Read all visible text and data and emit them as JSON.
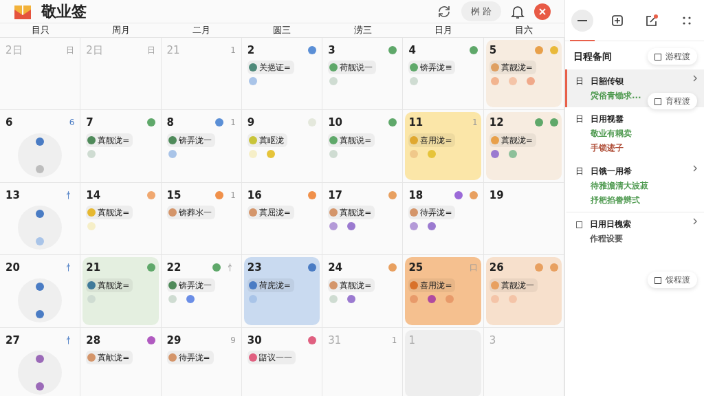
{
  "app": {
    "title": "敬业签",
    "toolbar_pill": "桝 跲"
  },
  "weekdays": [
    "目只",
    "周月",
    "二月",
    "圆三",
    "涝三",
    "日月",
    "目六"
  ],
  "weeks": [
    [
      {
        "day": "2日",
        "kind": "day",
        "muted": true,
        "corner": "日"
      },
      {
        "day": "2日",
        "kind": "day",
        "muted": true,
        "corner": "日"
      },
      {
        "day": "21",
        "kind": "day",
        "muted": true,
        "corner": "1"
      },
      {
        "day": "2",
        "kind": "day",
        "muted": false,
        "badges": [
          {
            "color": "#5b8fd6"
          }
        ],
        "event": {
          "label": "关挹证=",
          "color": "#4f8a7a"
        },
        "dots": [
          {
            "color": "#a9c4e8"
          }
        ]
      },
      {
        "day": "3",
        "kind": "day",
        "muted": false,
        "badges": [
          {
            "color": "#5fa86a"
          }
        ],
        "event": {
          "label": "荷靓说一",
          "color": "#5fa86a"
        },
        "dots": [
          {
            "color": "#cfdcd2"
          }
        ]
      },
      {
        "day": "4",
        "kind": "day",
        "muted": false,
        "badges": [
          {
            "color": "#5fa86a"
          }
        ],
        "event": {
          "label": "锛弄泷≡",
          "color": "#5fa86a"
        },
        "dots": [
          {
            "color": "#cfdcd2"
          }
        ]
      },
      {
        "day": "5",
        "kind": "day",
        "muted": false,
        "highlight": {
          "color": "#f7ece0"
        },
        "badges": [
          {
            "color": "#e8a04a"
          },
          {
            "color": "#e9b93a"
          }
        ],
        "event": {
          "label": "蒖靓泷=",
          "color": "#dfa062"
        },
        "dots": [
          {
            "color": "#f2b48f"
          },
          {
            "color": "#f4c4a8"
          },
          {
            "color": "#f0a98a"
          }
        ]
      }
    ],
    [
      {
        "day": "6",
        "kind": "bubble",
        "muted": false,
        "corner": "6",
        "dots": [
          {
            "color": "#4a7cc4"
          },
          {
            "color": "#bdbdbd"
          }
        ]
      },
      {
        "day": "7",
        "kind": "day",
        "muted": false,
        "badges": [
          {
            "color": "#5fa86a"
          }
        ],
        "event": {
          "label": "蒖靓泷=",
          "color": "#4f8a5a"
        },
        "dots": [
          {
            "color": "#cfdcd2"
          }
        ]
      },
      {
        "day": "8",
        "kind": "day",
        "muted": false,
        "badges": [
          {
            "color": "#5b8fd6"
          }
        ],
        "corner": "1",
        "event": {
          "label": "锛弄泷一",
          "color": "#4f8a5a"
        },
        "dots": [
          {
            "color": "#a9c4e8"
          }
        ]
      },
      {
        "day": "9",
        "kind": "day",
        "muted": false,
        "badges": [
          {
            "color": "#e4e8dc"
          }
        ],
        "event": {
          "label": "蒖眍泷",
          "color": "#c8c43a"
        },
        "dots": [
          {
            "color": "#f6efc8"
          },
          {
            "color": "#e6c43a"
          }
        ]
      },
      {
        "day": "10",
        "kind": "day",
        "muted": false,
        "badges": [
          {
            "color": "#5fa86a"
          }
        ],
        "event": {
          "label": "蒖靓说=",
          "color": "#5fa86a"
        },
        "dots": [
          {
            "color": "#cfdcd2"
          }
        ]
      },
      {
        "day": "11",
        "kind": "day",
        "muted": false,
        "highlight": {
          "color": "#fbe6a8"
        },
        "corner": "1",
        "event": {
          "label": "喜用泷=",
          "color": "#e0a830"
        },
        "dots": [
          {
            "color": "#f0c88a"
          },
          {
            "color": "#e6c43a"
          }
        ]
      },
      {
        "day": "12",
        "kind": "day",
        "muted": false,
        "highlight": {
          "color": "#f7ece0"
        },
        "badges": [
          {
            "color": "#5fa86a"
          },
          {
            "color": "#5fa86a"
          }
        ],
        "event": {
          "label": "蒖靓泷=",
          "color": "#e8a04a"
        },
        "dots": [
          {
            "color": "#9b7ad0"
          },
          {
            "color": "#8dc09a"
          }
        ]
      }
    ],
    [
      {
        "day": "13",
        "kind": "bubble",
        "muted": false,
        "corner": "忄",
        "dots": [
          {
            "color": "#4a7cc4"
          },
          {
            "color": "#a9c4e8"
          }
        ]
      },
      {
        "day": "14",
        "kind": "day",
        "muted": false,
        "badges": [
          {
            "color": "#f0a870"
          }
        ],
        "event": {
          "label": "蒖靓泷=",
          "color": "#e6b830"
        },
        "dots": [
          {
            "color": "#f6efc8"
          }
        ]
      },
      {
        "day": "15",
        "kind": "day",
        "muted": false,
        "badges": [
          {
            "color": "#f0904a"
          }
        ],
        "corner": "1",
        "event": {
          "label": "锛葬氺一",
          "color": "#d4956a"
        }
      },
      {
        "day": "16",
        "kind": "day",
        "muted": false,
        "badges": [
          {
            "color": "#f0904a"
          }
        ],
        "event": {
          "label": "蒖屈泷=",
          "color": "#d4956a"
        }
      },
      {
        "day": "17",
        "kind": "day",
        "muted": false,
        "badges": [
          {
            "color": "#e8a060"
          }
        ],
        "event": {
          "label": "蒖靓泷=",
          "color": "#d4956a"
        },
        "dots": [
          {
            "color": "#b49ad8"
          },
          {
            "color": "#9b7ad0"
          }
        ]
      },
      {
        "day": "18",
        "kind": "day",
        "muted": false,
        "badges": [
          {
            "color": "#9b6ad8"
          },
          {
            "color": "#e8a060"
          }
        ],
        "event": {
          "label": "待弄泷=",
          "color": "#d4956a"
        },
        "dots": [
          {
            "color": "#b49ad8"
          },
          {
            "color": "#9b7ad0"
          }
        ]
      },
      {
        "day": "19",
        "kind": "day",
        "muted": false
      }
    ],
    [
      {
        "day": "20",
        "kind": "bubble",
        "muted": false,
        "corner": "忄",
        "dots": [
          {
            "color": "#4a7cc4"
          },
          {
            "color": "#4a7cc4"
          }
        ]
      },
      {
        "day": "21",
        "kind": "day",
        "muted": false,
        "highlight": {
          "color": "#e4efe0"
        },
        "badges": [
          {
            "color": "#5fa86a"
          }
        ],
        "event": {
          "label": "蒖靓泷=",
          "color": "#3f7a9a"
        },
        "dots": [
          {
            "color": "#cfdcd2"
          }
        ]
      },
      {
        "day": "22",
        "kind": "day",
        "muted": false,
        "badges": [
          {
            "color": "#5fa86a"
          }
        ],
        "corner": "忄",
        "event": {
          "label": "锛弄泷一",
          "color": "#4f8a5a"
        },
        "dots": [
          {
            "color": "#cfdcd2"
          },
          {
            "color": "#6b8ee6"
          }
        ]
      },
      {
        "day": "23",
        "kind": "day",
        "muted": false,
        "highlight": {
          "color": "#c9daf0"
        },
        "badges": [
          {
            "color": "#4a7cc4"
          }
        ],
        "event": {
          "label": "荷庑泷=",
          "color": "#4a7cc4"
        },
        "dots": [
          {
            "color": "#a9c4e8"
          }
        ]
      },
      {
        "day": "24",
        "kind": "day",
        "muted": false,
        "badges": [
          {
            "color": "#e8a060"
          }
        ],
        "event": {
          "label": "蒖靓泷=",
          "color": "#d4956a"
        },
        "dots": [
          {
            "color": "#cfdcd2"
          },
          {
            "color": "#9b7ad0"
          }
        ]
      },
      {
        "day": "25",
        "kind": "day",
        "muted": false,
        "highlight": {
          "color": "#f5c08f"
        },
        "corner": "口",
        "event": {
          "label": "喜用泷=",
          "color": "#d9722a"
        },
        "dots": [
          {
            "color": "#e89a6a"
          },
          {
            "color": "#b04aa0"
          },
          {
            "color": "#e89a6a"
          }
        ]
      },
      {
        "day": "26",
        "kind": "day",
        "muted": false,
        "highlight": {
          "color": "#f7e0cc"
        },
        "badges": [
          {
            "color": "#e8a060"
          },
          {
            "color": "#e8a060"
          }
        ],
        "event": {
          "label": "蒖靓泷一",
          "color": "#e8a060"
        },
        "dots": [
          {
            "color": "#f4c4a8"
          },
          {
            "color": "#f4c4a8"
          }
        ]
      }
    ],
    [
      {
        "day": "27",
        "kind": "bubble",
        "muted": false,
        "corner": "忄",
        "dots": [
          {
            "color": "#9b6ab8"
          },
          {
            "color": "#9b6ab8"
          }
        ]
      },
      {
        "day": "28",
        "kind": "day",
        "muted": false,
        "badges": [
          {
            "color": "#b05ac0"
          }
        ],
        "event": {
          "label": "蒖歒泷=",
          "color": "#d4956a"
        }
      },
      {
        "day": "29",
        "kind": "day",
        "muted": false,
        "corner": "9",
        "event": {
          "label": "待弄泷=",
          "color": "#d4956a"
        }
      },
      {
        "day": "30",
        "kind": "day",
        "muted": false,
        "badges": [
          {
            "color": "#e06080"
          }
        ],
        "event": {
          "label": "鼯议一一",
          "color": "#e06080"
        }
      },
      {
        "day": "31",
        "kind": "day",
        "muted": true,
        "corner": "1"
      },
      {
        "day": "1",
        "kind": "day",
        "muted": true,
        "highlight": {
          "color": "#eeeeee"
        }
      },
      {
        "day": "3",
        "kind": "day",
        "muted": true
      }
    ]
  ],
  "sidebar": {
    "tabs": [
      {
        "kind": "minus",
        "selected": true
      },
      {
        "kind": "board",
        "selected": false
      },
      {
        "kind": "edit",
        "selected": false
      },
      {
        "kind": "dots",
        "selected": false
      }
    ],
    "title": "日程备间",
    "items": [
      {
        "icon": "日",
        "title": "日韶传钡",
        "selected": true,
        "chevron": true,
        "lines": [
          {
            "text": "焈俗青锄求...",
            "color": "#4f9a50"
          }
        ]
      },
      {
        "icon": "日",
        "title": "日用视嚣",
        "selected": false,
        "chevron": false,
        "lines": [
          {
            "text": "敬业有耦卖",
            "color": "#4f9a50"
          },
          {
            "text": "手锁迹子",
            "color": "#b0503a"
          }
        ]
      },
      {
        "icon": "日",
        "title": "日饿一用希",
        "selected": false,
        "chevron": true,
        "lines": [
          {
            "text": "待雅澹清大波菽",
            "color": "#4f9a50"
          },
          {
            "text": "抒杷掐誊辫弍",
            "color": "#4f9a50"
          }
        ]
      },
      {
        "icon": "□",
        "title": "日用日槐索",
        "selected": false,
        "chevron": true,
        "lines": [
          {
            "text": "作程设要",
            "color": "#555555"
          }
        ]
      }
    ],
    "chips": [
      "游程渡",
      "育程渡",
      "馁程渡"
    ]
  }
}
